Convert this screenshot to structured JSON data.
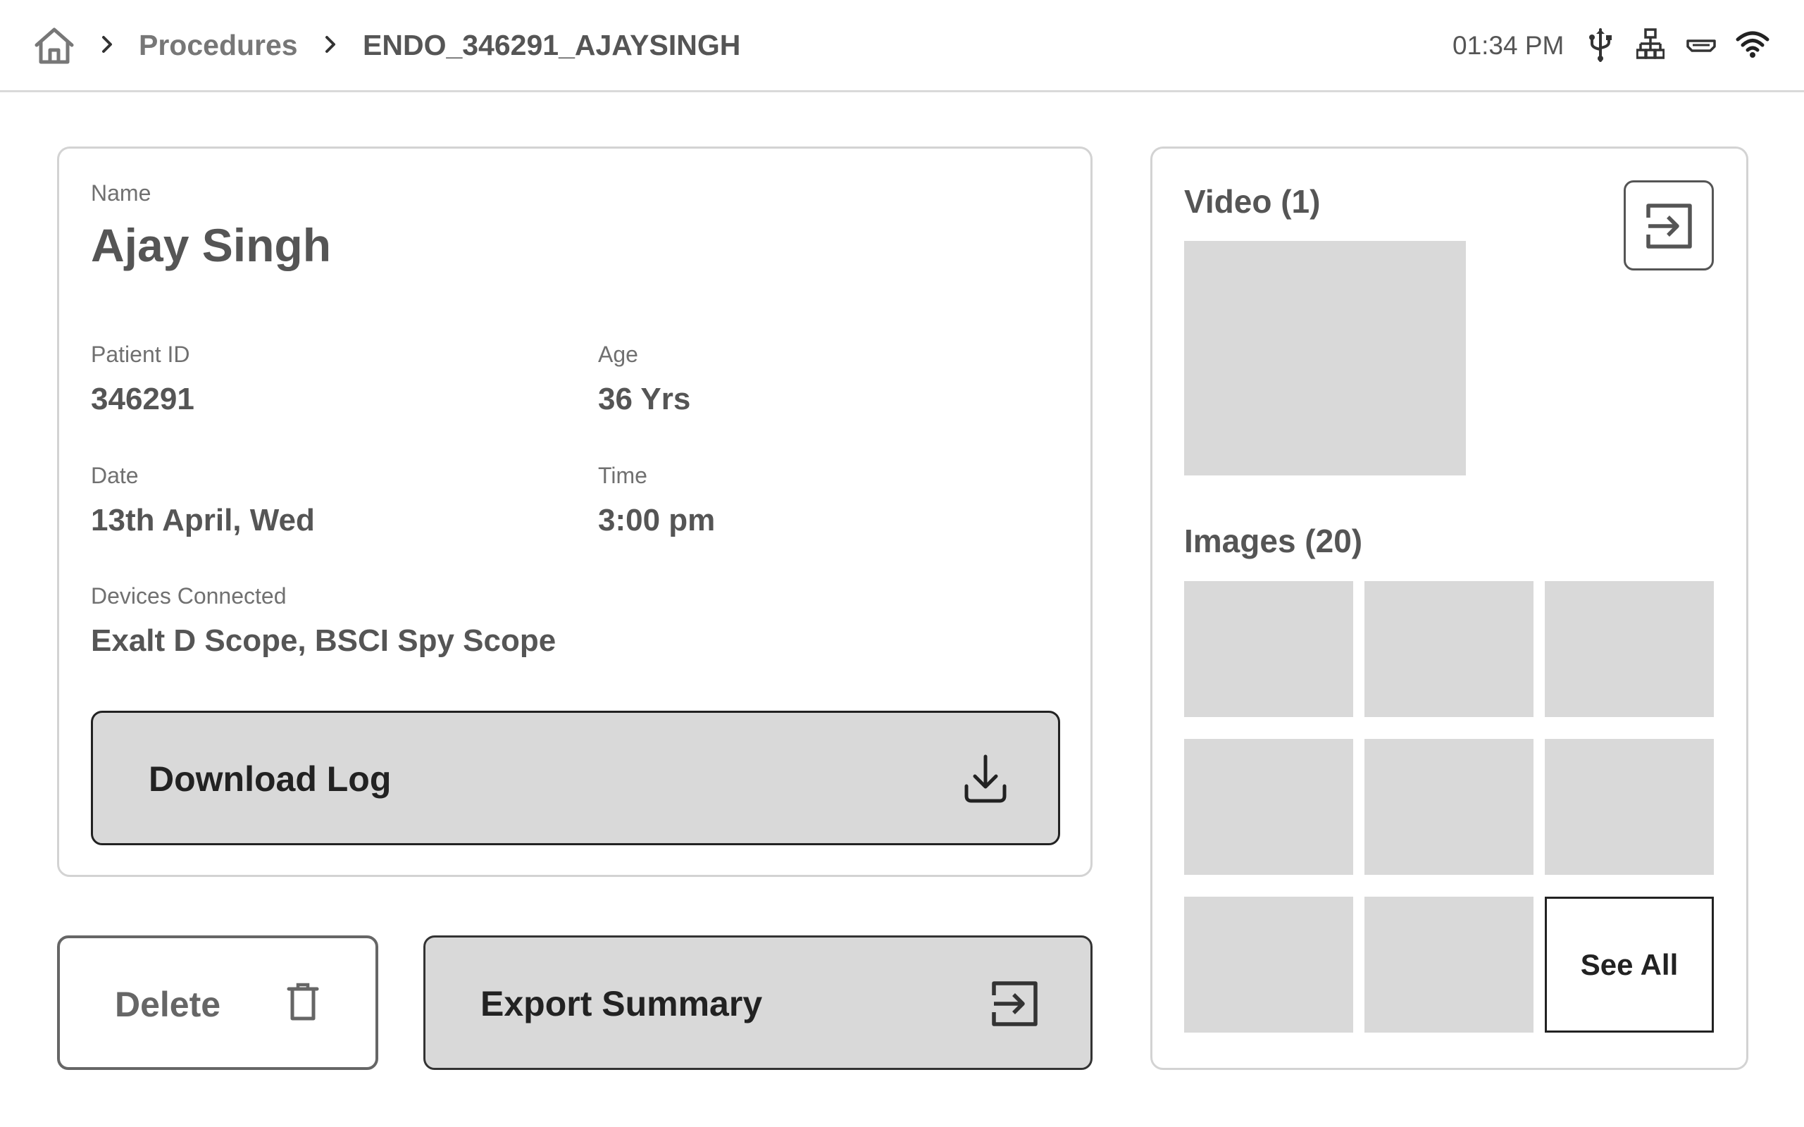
{
  "topbar": {
    "breadcrumb": {
      "home_icon": "home-icon",
      "procedures": "Procedures",
      "current": "ENDO_346291_AJAYSINGH"
    },
    "time": "01:34 PM",
    "status_icons": [
      "usb-icon",
      "network-icon",
      "hdmi-icon",
      "wifi-icon"
    ]
  },
  "patient": {
    "name_label": "Name",
    "name": "Ajay Singh",
    "patient_id_label": "Patient ID",
    "patient_id": "346291",
    "age_label": "Age",
    "age": "36 Yrs",
    "date_label": "Date",
    "date": "13th April, Wed",
    "time_label": "Time",
    "time": "3:00 pm",
    "devices_label": "Devices Connected",
    "devices": "Exalt D Scope, BSCI Spy Scope",
    "download_label": "Download Log"
  },
  "actions": {
    "delete_label": "Delete",
    "export_label": "Export Summary"
  },
  "media": {
    "video_title": "Video (1)",
    "images_title": "Images (20)",
    "see_all_label": "See All"
  },
  "colors": {
    "placeholder": "#d9d9d9",
    "text": "#555555",
    "border": "#d3d3d3"
  }
}
